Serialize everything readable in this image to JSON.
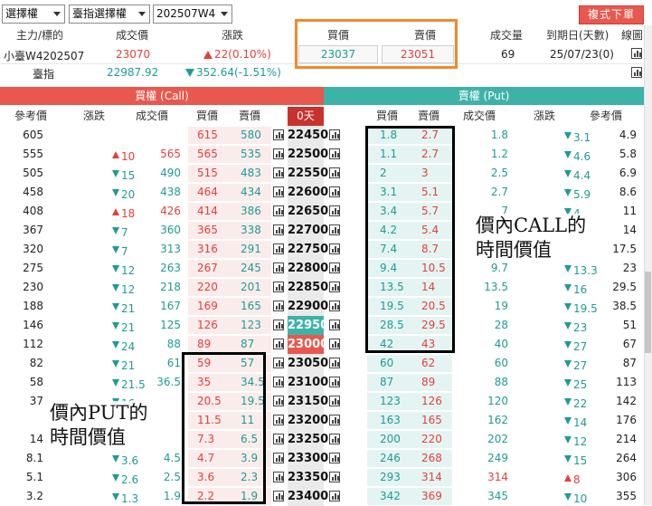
{
  "toolbar": {
    "type_select": "選擇權",
    "underlying_select": "臺指選擇權",
    "contract_select": "202507W4",
    "order_button": "複式下單"
  },
  "info": {
    "headers": [
      "主力/標的",
      "成交價",
      "漲跌",
      "買價",
      "賣價",
      "成交量",
      "到期日(天數)",
      "線圖"
    ],
    "main": {
      "name": "小臺W4202507",
      "last": "23070",
      "change": "22(0.10%)",
      "bid": "23037",
      "ask": "23051",
      "volume": "69",
      "expiry": "25/07/23(0)"
    },
    "index": {
      "name": "臺指",
      "last": "22987.92",
      "change": "352.64(-1.51%)"
    }
  },
  "banners": {
    "call": "買權 (Call)",
    "put": "賣權 (Put)"
  },
  "columns": {
    "call": [
      "參考價",
      "漲跌",
      "成交價",
      "買價",
      "賣價"
    ],
    "days": "0天",
    "put": [
      "買價",
      "賣價",
      "成交價",
      "漲跌",
      "參考價"
    ]
  },
  "rows": [
    {
      "strike": "22450",
      "c_ref": "605",
      "c_chg": "",
      "c_dir": "",
      "c_last": "",
      "c_bid": "615",
      "c_ask": "580",
      "p_bid": "1.8",
      "p_ask": "2.7",
      "p_last": "1.8",
      "p_chg": "3.1",
      "p_dir": "dn",
      "p_ref": "4.9"
    },
    {
      "strike": "22500",
      "c_ref": "555",
      "c_chg": "10",
      "c_dir": "up",
      "c_last": "565",
      "c_bid": "565",
      "c_ask": "535",
      "p_bid": "1.1",
      "p_ask": "2.7",
      "p_last": "1.2",
      "p_chg": "4.6",
      "p_dir": "dn",
      "p_ref": "5.8"
    },
    {
      "strike": "22550",
      "c_ref": "505",
      "c_chg": "15",
      "c_dir": "dn",
      "c_last": "490",
      "c_bid": "515",
      "c_ask": "483",
      "p_bid": "2",
      "p_ask": "3",
      "p_last": "2.5",
      "p_chg": "4.4",
      "p_dir": "dn",
      "p_ref": "6.9"
    },
    {
      "strike": "22600",
      "c_ref": "458",
      "c_chg": "20",
      "c_dir": "dn",
      "c_last": "438",
      "c_bid": "464",
      "c_ask": "434",
      "p_bid": "3.1",
      "p_ask": "5.1",
      "p_last": "2.7",
      "p_chg": "5.9",
      "p_dir": "dn",
      "p_ref": "8.6"
    },
    {
      "strike": "22650",
      "c_ref": "408",
      "c_chg": "18",
      "c_dir": "up",
      "c_last": "426",
      "c_bid": "414",
      "c_ask": "386",
      "p_bid": "3.4",
      "p_ask": "5.7",
      "p_last": "7",
      "p_chg": "4",
      "p_dir": "dn",
      "p_ref": "11"
    },
    {
      "strike": "22700",
      "c_ref": "367",
      "c_chg": "7",
      "c_dir": "dn",
      "c_last": "360",
      "c_bid": "365",
      "c_ask": "338",
      "p_bid": "4.2",
      "p_ask": "5.4",
      "p_last": "",
      "p_chg": "",
      "p_dir": "",
      "p_ref": "14"
    },
    {
      "strike": "22750",
      "c_ref": "320",
      "c_chg": "7",
      "c_dir": "dn",
      "c_last": "313",
      "c_bid": "316",
      "c_ask": "291",
      "p_bid": "7.4",
      "p_ask": "8.7",
      "p_last": "",
      "p_chg": "",
      "p_dir": "",
      "p_ref": "17.5"
    },
    {
      "strike": "22800",
      "c_ref": "275",
      "c_chg": "12",
      "c_dir": "dn",
      "c_last": "263",
      "c_bid": "267",
      "c_ask": "245",
      "p_bid": "9.4",
      "p_ask": "10.5",
      "p_last": "9.7",
      "p_chg": "13.3",
      "p_dir": "dn",
      "p_ref": "23"
    },
    {
      "strike": "22850",
      "c_ref": "230",
      "c_chg": "12",
      "c_dir": "dn",
      "c_last": "218",
      "c_bid": "220",
      "c_ask": "201",
      "p_bid": "13.5",
      "p_ask": "14",
      "p_last": "13.5",
      "p_chg": "16",
      "p_dir": "dn",
      "p_ref": "29.5"
    },
    {
      "strike": "22900",
      "c_ref": "188",
      "c_chg": "21",
      "c_dir": "dn",
      "c_last": "167",
      "c_bid": "169",
      "c_ask": "165",
      "p_bid": "19.5",
      "p_ask": "20.5",
      "p_last": "19",
      "p_chg": "19.5",
      "p_dir": "dn",
      "p_ref": "38.5"
    },
    {
      "strike": "22950",
      "c_ref": "146",
      "c_chg": "21",
      "c_dir": "dn",
      "c_last": "125",
      "c_bid": "126",
      "c_ask": "123",
      "p_bid": "28.5",
      "p_ask": "29.5",
      "p_last": "28",
      "p_chg": "23",
      "p_dir": "dn",
      "p_ref": "51"
    },
    {
      "strike": "23000",
      "c_ref": "112",
      "c_chg": "24",
      "c_dir": "dn",
      "c_last": "88",
      "c_bid": "89",
      "c_ask": "87",
      "p_bid": "42",
      "p_ask": "43",
      "p_last": "40",
      "p_chg": "27",
      "p_dir": "dn",
      "p_ref": "67"
    },
    {
      "strike": "23050",
      "c_ref": "82",
      "c_chg": "21",
      "c_dir": "dn",
      "c_last": "61",
      "c_bid": "59",
      "c_ask": "57",
      "p_bid": "60",
      "p_ask": "62",
      "p_last": "60",
      "p_chg": "27",
      "p_dir": "dn",
      "p_ref": "87"
    },
    {
      "strike": "23100",
      "c_ref": "58",
      "c_chg": "21.5",
      "c_dir": "dn",
      "c_last": "36.5",
      "c_bid": "35",
      "c_ask": "34.5",
      "p_bid": "87",
      "p_ask": "89",
      "p_last": "88",
      "p_chg": "25",
      "p_dir": "dn",
      "p_ref": "113"
    },
    {
      "strike": "23150",
      "c_ref": "37",
      "c_chg": "16",
      "c_dir": "dn",
      "c_last": "",
      "c_bid": "20.5",
      "c_ask": "19.5",
      "p_bid": "123",
      "p_ask": "126",
      "p_last": "120",
      "p_chg": "22",
      "p_dir": "dn",
      "p_ref": "142"
    },
    {
      "strike": "23200",
      "c_ref": "",
      "c_chg": "",
      "c_dir": "",
      "c_last": "",
      "c_bid": "11.5",
      "c_ask": "11",
      "p_bid": "163",
      "p_ask": "165",
      "p_last": "162",
      "p_chg": "14",
      "p_dir": "dn",
      "p_ref": "176"
    },
    {
      "strike": "23250",
      "c_ref": "14",
      "c_chg": "",
      "c_dir": "",
      "c_last": "",
      "c_bid": "7.3",
      "c_ask": "6.5",
      "p_bid": "200",
      "p_ask": "220",
      "p_last": "202",
      "p_chg": "12",
      "p_dir": "dn",
      "p_ref": "214"
    },
    {
      "strike": "23300",
      "c_ref": "8.1",
      "c_chg": "3.6",
      "c_dir": "dn",
      "c_last": "4.5",
      "c_bid": "4.7",
      "c_ask": "3.9",
      "p_bid": "246",
      "p_ask": "268",
      "p_last": "249",
      "p_chg": "15",
      "p_dir": "dn",
      "p_ref": "264"
    },
    {
      "strike": "23350",
      "c_ref": "5.1",
      "c_chg": "2.6",
      "c_dir": "dn",
      "c_last": "2.5",
      "c_bid": "3.6",
      "c_ask": "2.3",
      "p_bid": "293",
      "p_ask": "314",
      "p_last": "314",
      "p_chg": "8",
      "p_dir": "up",
      "p_ref": "306"
    },
    {
      "strike": "23400",
      "c_ref": "3.2",
      "c_chg": "1.3",
      "c_dir": "dn",
      "c_last": "1.9",
      "c_bid": "2.2",
      "c_ask": "1.9",
      "p_bid": "342",
      "p_ask": "369",
      "p_last": "345",
      "p_chg": "10",
      "p_dir": "dn",
      "p_ref": "355"
    }
  ],
  "annotations": {
    "call_line1": "價內CALL的",
    "call_line2": "時間價值",
    "put_line1": "價內PUT的",
    "put_line2": "時間價值"
  },
  "colors": {
    "call": "#e8584e",
    "put": "#3db3a8",
    "up": "#e2413a",
    "down": "#1f9b96",
    "highlight": "#f08a2a"
  }
}
